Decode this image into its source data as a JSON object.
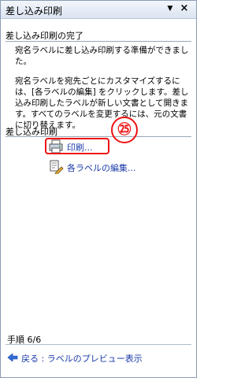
{
  "pane": {
    "title": "差し込み印刷",
    "dropdown_glyph": "▼",
    "close_glyph": "×"
  },
  "complete_section": {
    "heading": "差し込み印刷の完了",
    "paragraph1": "宛名ラベルに差し込み印刷する準備ができました。",
    "paragraph2": "宛名ラベルを宛先ごとにカスタマイズするには、[各ラベルの編集] をクリックします。差し込み印刷したラベルが新しい文書として開きます。すべてのラベルを変更するには、元の文書に切り替えます。"
  },
  "merge_section": {
    "heading": "差し込み印刷",
    "print_link": "印刷...",
    "edit_link": "各ラベルの編集..."
  },
  "annotation": {
    "step_marker": "㉕",
    "highlight_color": "#ee1111"
  },
  "footer": {
    "step": "手順 6/6",
    "back_link": "戻る : ラベルのプレビュー表示"
  },
  "colors": {
    "link": "#1a3aa8",
    "title_bar": "#dbe4f1"
  }
}
